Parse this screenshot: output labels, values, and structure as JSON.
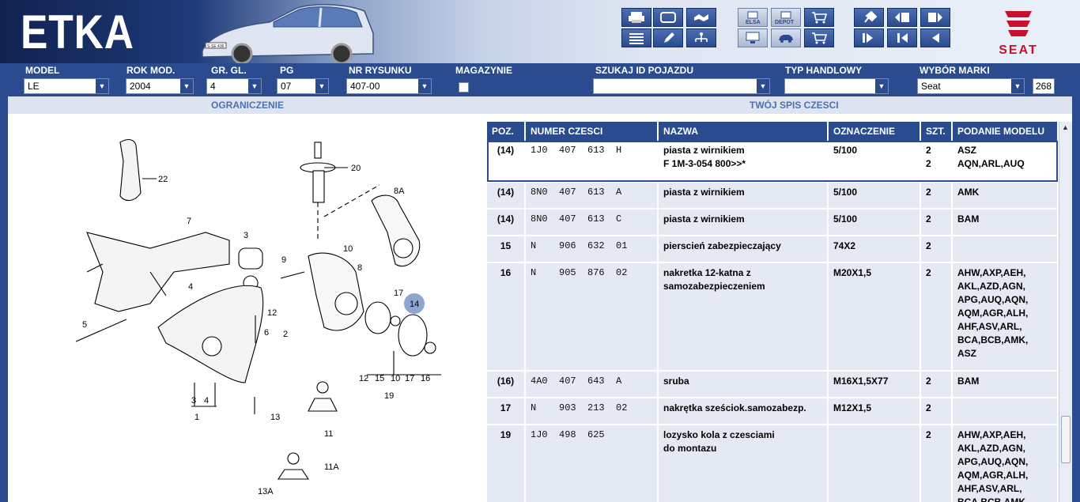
{
  "app": {
    "logo": "ETKA",
    "brand_logo": "SEAT",
    "car_plate": "S·SE 436"
  },
  "toolbar": {
    "group1": [
      "printer-icon",
      "frame-icon",
      "handshake-icon",
      "list-icon",
      "pencil-icon",
      "tree-icon"
    ],
    "group2_labels": [
      "ELSA",
      "DEPOT"
    ],
    "group2": [
      "elsa-icon",
      "depot-icon",
      "cart-plus-icon",
      "monitor-icon",
      "car-icon",
      "cart-icon"
    ],
    "group3": [
      "pin-icon",
      "page-back-icon",
      "page-forward-icon",
      "first-icon",
      "back-first-icon",
      "back-icon"
    ]
  },
  "filters": {
    "model": {
      "label": "MODEL",
      "value": "LE"
    },
    "rok_mod": {
      "label": "ROK MOD.",
      "value": "2004"
    },
    "gr_gl": {
      "label": "GR. GL.",
      "value": "4"
    },
    "pg": {
      "label": "PG",
      "value": "07"
    },
    "nr_rysunku": {
      "label": "NR RYSUNKU",
      "value": "407-00"
    },
    "magazynie": {
      "label": "MAGAZYNIE",
      "checked": false
    },
    "szukaj": {
      "label": "SZUKAJ ID POJAZDU",
      "value": ""
    },
    "typ": {
      "label": "TYP HANDLOWY",
      "value": ""
    },
    "marka": {
      "label": "WYBÓR MARKI",
      "value": "Seat"
    },
    "count": "268"
  },
  "sections": {
    "left": "OGRANICZENIE",
    "right": "TWÓJ SPIS CZESCI"
  },
  "diagram_labels": {
    "l22": "22",
    "l20": "20",
    "l8a": "8A",
    "l7": "7",
    "l3": "3",
    "l10": "10",
    "l9": "9",
    "l8": "8",
    "l4": "4",
    "l17": "17",
    "l14": "14",
    "l12": "12",
    "l5": "5",
    "l6": "6",
    "l2": "2",
    "l12b": "12",
    "l15": "15",
    "l10b": "10",
    "l17b": "17",
    "l16": "16",
    "l19": "19",
    "l3b": "3",
    "l4b": "4",
    "l1": "1",
    "l13": "13",
    "l11": "11",
    "l11a": "11A",
    "l13a": "13A"
  },
  "table": {
    "headers": [
      "POZ.",
      "NUMER CZESCI",
      "NAZWA",
      "OZNACZENIE",
      "SZT.",
      "PODANIE MODELU"
    ],
    "rows": [
      {
        "poz": "(14)",
        "nr": "1J0  407  613  H",
        "nazwa": "piasta z wirnikiem\nF 1M-3-054 800>>*",
        "ozn": "5/100",
        "szt": "2\n2",
        "model": "ASZ\nAQN,ARL,AUQ",
        "selected": true
      },
      {
        "poz": "(14)",
        "nr": "8N0  407  613  A",
        "nazwa": "piasta z wirnikiem",
        "ozn": "5/100",
        "szt": "2",
        "model": "AMK"
      },
      {
        "poz": "(14)",
        "nr": "8N0  407  613  C",
        "nazwa": "piasta z wirnikiem",
        "ozn": "5/100",
        "szt": "2",
        "model": "BAM"
      },
      {
        "poz": "15",
        "nr": "N    906  632  01",
        "nazwa": "pierscień zabezpieczający",
        "ozn": "74X2",
        "szt": "2",
        "model": ""
      },
      {
        "poz": "16",
        "nr": "N    905  876  02",
        "nazwa": "nakretka 12-katna z\nsamozabezpieczeniem",
        "ozn": "M20X1,5",
        "szt": "2",
        "model": "AHW,AXP,AEH,\nAKL,AZD,AGN,\nAPG,AUQ,AQN,\nAQM,AGR,ALH,\nAHF,ASV,ARL,\nBCA,BCB,AMK,\nASZ"
      },
      {
        "poz": "(16)",
        "nr": "4A0  407  643  A",
        "nazwa": "sruba",
        "ozn": "M16X1,5X77",
        "szt": "2",
        "model": "BAM"
      },
      {
        "poz": "17",
        "nr": "N    903  213  02",
        "nazwa": "nakrętka sześciok.samozabezp.",
        "ozn": "M12X1,5",
        "szt": "2",
        "model": ""
      },
      {
        "poz": "19",
        "nr": "1J0  498  625",
        "nazwa": "lozysko kola z czesciami\ndo montazu",
        "ozn": "",
        "szt": "2",
        "model": "AHW,AXP,AEH,\nAKL,AZD,AGN,\nAPG,AUQ,AQN,\nAQM,AGR,ALH,\nAHF,ASV,ARL,\nBCA,BCB,AMK,"
      }
    ]
  }
}
